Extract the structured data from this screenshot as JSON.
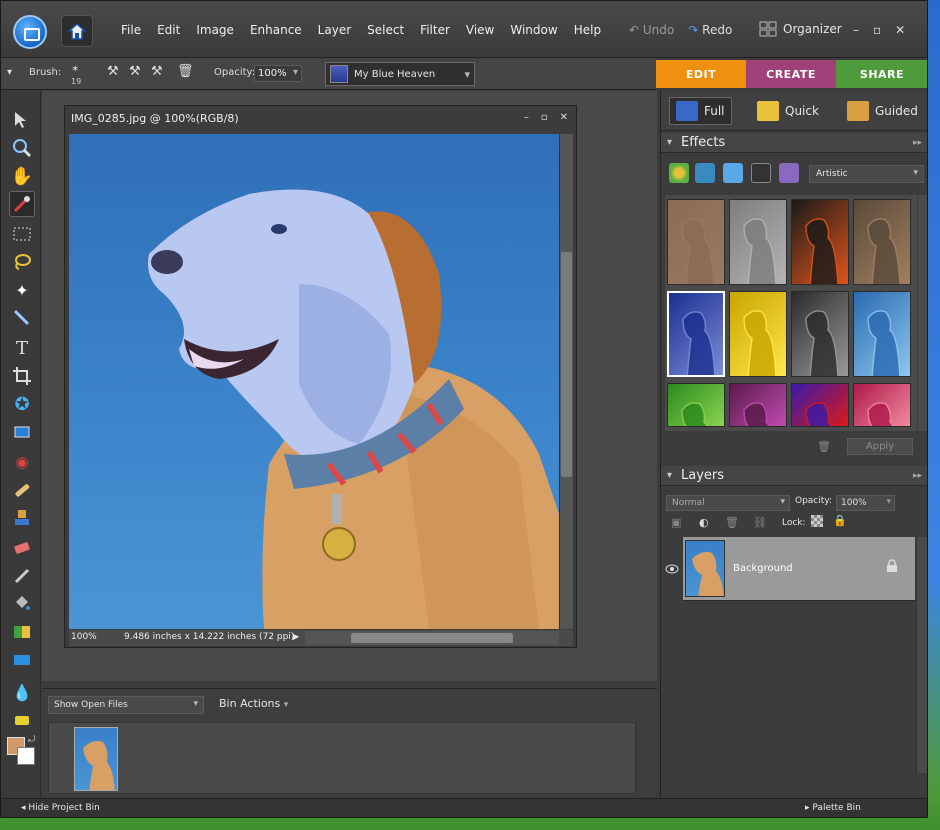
{
  "menubar": {
    "items": [
      "File",
      "Edit",
      "Image",
      "Enhance",
      "Layer",
      "Select",
      "Filter",
      "View",
      "Window",
      "Help"
    ],
    "undo": "Undo",
    "redo": "Redo",
    "organizer": "Organizer"
  },
  "options": {
    "brush_label": "Brush:",
    "brush_size": "19",
    "opacity_label": "Opacity:",
    "opacity_value": "100%",
    "preset": "My Blue Heaven"
  },
  "modes": {
    "edit": "EDIT",
    "create": "CREATE",
    "share": "SHARE",
    "edit_color": "#f0900f",
    "create_color": "#a0417a",
    "share_color": "#4f9a3a"
  },
  "document": {
    "title": "IMG_0285.jpg @ 100%(RGB/8)",
    "zoom": "100%",
    "dimensions": "9.486 inches x 14.222 inches (72 ppi)"
  },
  "bin": {
    "show_label": "Show Open Files",
    "actions_label": "Bin Actions"
  },
  "bottom": {
    "hide_bin": "Hide Project Bin",
    "palette_bin": "Palette Bin"
  },
  "edit_modes": {
    "full": "Full",
    "quick": "Quick",
    "guided": "Guided"
  },
  "effects": {
    "header": "Effects",
    "category": "Artistic",
    "apply": "Apply",
    "swatches": [
      [
        "#8c6b55",
        "#9a7a62"
      ],
      [
        "#7d7d7d",
        "#b5b5b5"
      ],
      [
        "#1a1a1a",
        "#e0551c"
      ],
      [
        "#5a4a3a",
        "#a08060"
      ],
      [
        "#1b2f8f",
        "#7b8cd8"
      ],
      [
        "#c9a500",
        "#ffe84a"
      ],
      [
        "#2b2b2b",
        "#9a9a9a"
      ],
      [
        "#2a6ab0",
        "#8ec7ef"
      ],
      [
        "#2b8a1c",
        "#8bd452"
      ],
      [
        "#5a1a4a",
        "#c04cb0"
      ],
      [
        "#3a1aa8",
        "#d81a1a"
      ],
      [
        "#b01a4a",
        "#f08aa0"
      ]
    ]
  },
  "layers": {
    "header": "Layers",
    "blend_mode": "Normal",
    "opacity_label": "Opacity:",
    "opacity_value": "100%",
    "lock_label": "Lock:",
    "layer_name": "Background"
  }
}
